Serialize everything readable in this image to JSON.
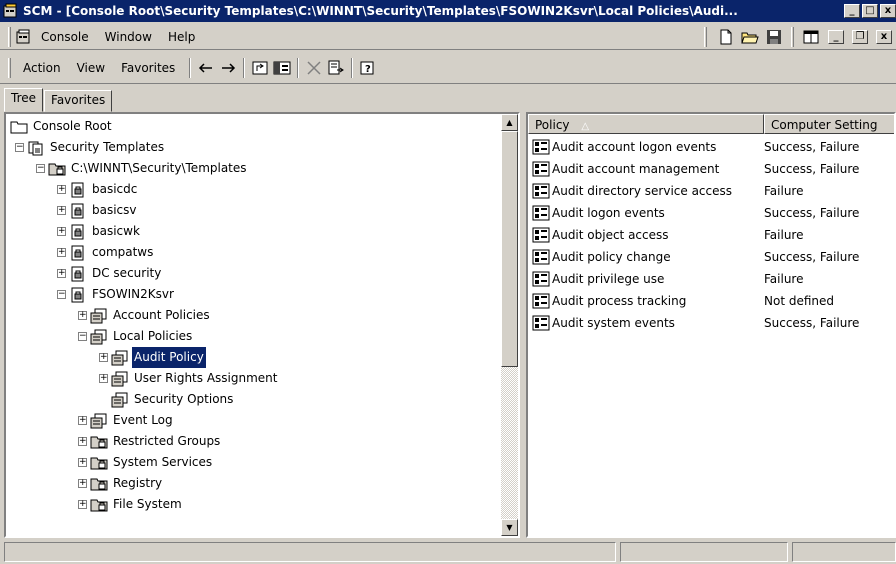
{
  "window": {
    "title": "SCM - [Console Root\\Security Templates\\C:\\WINNT\\Security\\Templates\\FSOWIN2Ksvr\\Local Policies\\Audi...",
    "min_glyph": "_",
    "max_glyph": "□",
    "close_glyph": "x"
  },
  "menu": {
    "console": "Console",
    "window": "Window",
    "help": "Help",
    "child_min": "_",
    "child_restore": "❐",
    "child_close": "x"
  },
  "toolbar": {
    "action": "Action",
    "view": "View",
    "favorites": "Favorites"
  },
  "tabs": {
    "tree": "Tree",
    "favorites": "Favorites"
  },
  "tree": [
    {
      "label": "Console Root",
      "level": 0,
      "icon": "folder-icon",
      "expander": ""
    },
    {
      "label": "Security Templates",
      "level": 1,
      "icon": "templates-icon",
      "expander": "−"
    },
    {
      "label": "C:\\WINNT\\Security\\Templates",
      "level": 2,
      "icon": "folder-lock-icon",
      "expander": "−"
    },
    {
      "label": "basicdc",
      "level": 3,
      "icon": "template-file-icon",
      "expander": "+"
    },
    {
      "label": "basicsv",
      "level": 3,
      "icon": "template-file-icon",
      "expander": "+"
    },
    {
      "label": "basicwk",
      "level": 3,
      "icon": "template-file-icon",
      "expander": "+"
    },
    {
      "label": "compatws",
      "level": 3,
      "icon": "template-file-icon",
      "expander": "+"
    },
    {
      "label": "DC security",
      "level": 3,
      "icon": "template-file-icon",
      "expander": "+"
    },
    {
      "label": "FSOWIN2Ksvr",
      "level": 3,
      "icon": "template-file-icon",
      "expander": "−"
    },
    {
      "label": "Account Policies",
      "level": 4,
      "icon": "policy-icon",
      "expander": "+"
    },
    {
      "label": "Local Policies",
      "level": 4,
      "icon": "policy-icon",
      "expander": "−"
    },
    {
      "label": "Audit Policy",
      "level": 5,
      "icon": "policy-icon",
      "expander": "+",
      "selected": true
    },
    {
      "label": "User Rights Assignment",
      "level": 5,
      "icon": "policy-icon",
      "expander": "+"
    },
    {
      "label": "Security Options",
      "level": 5,
      "icon": "policy-icon",
      "expander": ""
    },
    {
      "label": "Event Log",
      "level": 4,
      "icon": "policy-icon",
      "expander": "+"
    },
    {
      "label": "Restricted Groups",
      "level": 4,
      "icon": "folder-lock-icon",
      "expander": "+"
    },
    {
      "label": "System Services",
      "level": 4,
      "icon": "folder-lock-icon",
      "expander": "+"
    },
    {
      "label": "Registry",
      "level": 4,
      "icon": "folder-lock-icon",
      "expander": "+"
    },
    {
      "label": "File System",
      "level": 4,
      "icon": "folder-lock-icon",
      "expander": "+"
    }
  ],
  "list": {
    "col_policy": "Policy",
    "sort_glyph": "△",
    "col_setting": "Computer Setting",
    "rows": [
      {
        "policy": "Audit account logon events",
        "setting": "Success, Failure"
      },
      {
        "policy": "Audit account management",
        "setting": "Success, Failure"
      },
      {
        "policy": "Audit directory service access",
        "setting": "Failure"
      },
      {
        "policy": "Audit logon events",
        "setting": "Success, Failure"
      },
      {
        "policy": "Audit object access",
        "setting": "Failure"
      },
      {
        "policy": "Audit policy change",
        "setting": "Success, Failure"
      },
      {
        "policy": "Audit privilege use",
        "setting": "Failure"
      },
      {
        "policy": "Audit process tracking",
        "setting": "Not defined"
      },
      {
        "policy": "Audit system events",
        "setting": "Success, Failure"
      }
    ]
  },
  "colors": {
    "titlebar": "#0a246a",
    "face": "#d4d0c8",
    "selection": "#0a246a"
  }
}
